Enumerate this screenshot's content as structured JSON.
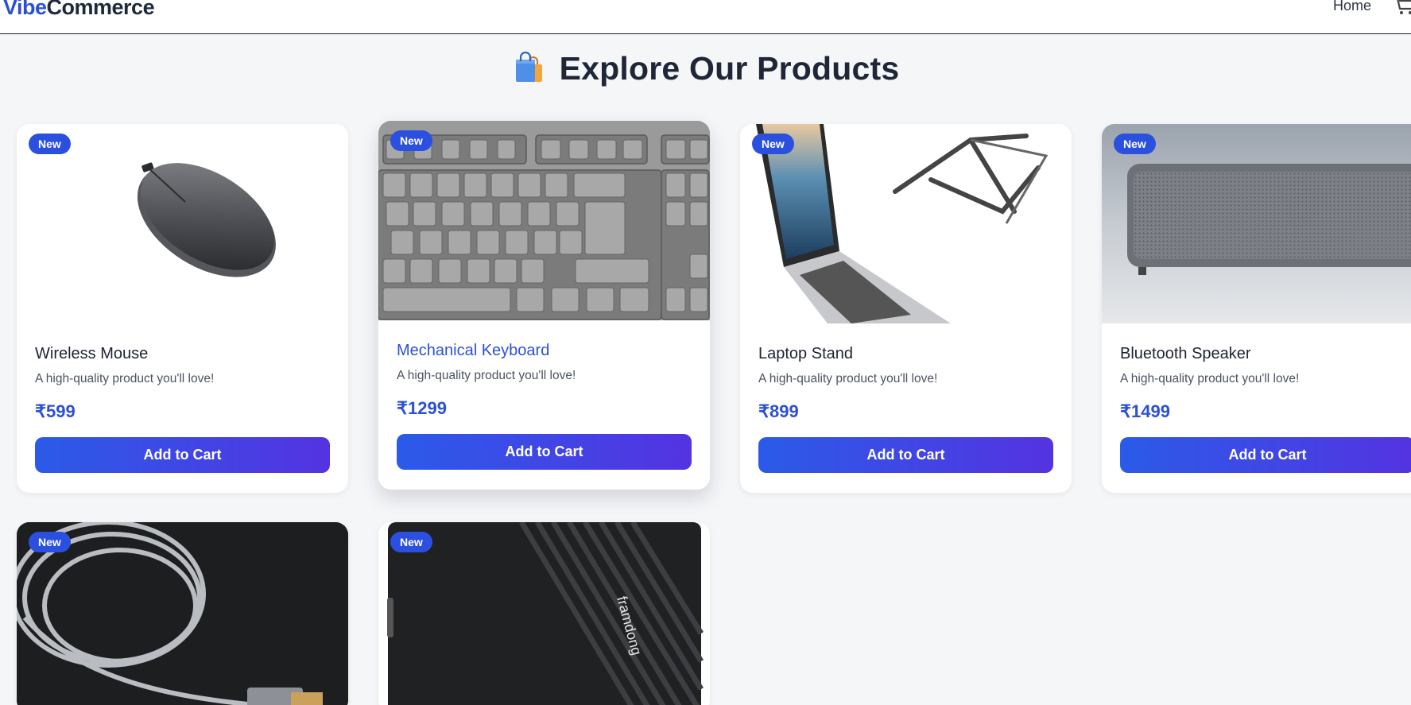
{
  "header": {
    "logo_part1": "Vibe",
    "logo_part2": "Commerce",
    "nav_home": "Home",
    "cart_icon": "shopping-cart-icon"
  },
  "page": {
    "title": "Explore Our Products",
    "title_icon": "shopping-bags-icon"
  },
  "colors": {
    "accent": "#2b50d6",
    "badge": "#2b50e0",
    "button_gradient_start": "#2b5be8",
    "button_gradient_end": "#5433e0",
    "background": "#f5f6f8"
  },
  "products": [
    {
      "badge": "New",
      "name": "Wireless Mouse",
      "description": "A high-quality product you'll love!",
      "price": "₹599",
      "button": "Add to Cart",
      "image_icon": "wireless-mouse-image"
    },
    {
      "badge": "New",
      "name": "Mechanical Keyboard",
      "description": "A high-quality product you'll love!",
      "price": "₹1299",
      "button": "Add to Cart",
      "image_icon": "keyboard-image"
    },
    {
      "badge": "New",
      "name": "Laptop Stand",
      "description": "A high-quality product you'll love!",
      "price": "₹899",
      "button": "Add to Cart",
      "image_icon": "laptop-stand-image"
    },
    {
      "badge": "New",
      "name": "Bluetooth Speaker",
      "description": "A high-quality product you'll love!",
      "price": "₹1499",
      "button": "Add to Cart",
      "image_icon": "bluetooth-speaker-image"
    },
    {
      "badge": "New",
      "image_icon": "usb-cable-image"
    },
    {
      "badge": "New",
      "image_icon": "power-bank-image"
    }
  ]
}
